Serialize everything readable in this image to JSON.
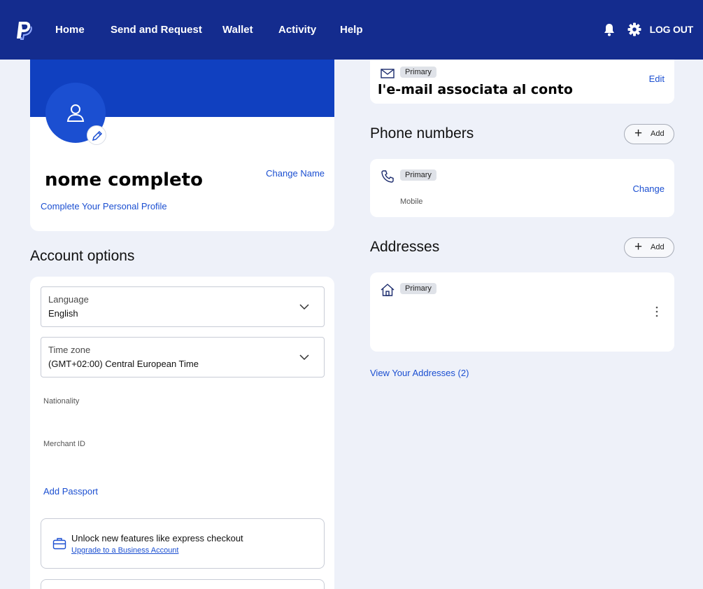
{
  "nav": {
    "items": [
      "Home",
      "Send and Request",
      "Wallet",
      "Activity",
      "Help"
    ],
    "logout": "LOG OUT"
  },
  "profile": {
    "full_name": "nome completo",
    "change_name": "Change Name",
    "complete_profile": "Complete Your Personal Profile"
  },
  "account_options": {
    "title": "Account options",
    "language_label": "Language",
    "language_value": "English",
    "timezone_label": "Time zone",
    "timezone_value": "(GMT+02:00) Central European Time",
    "nationality_label": "Nationality",
    "merchant_label": "Merchant ID",
    "add_passport": "Add Passport",
    "unlock_text": "Unlock new features like express checkout",
    "upgrade_link": "Upgrade to a Business Account"
  },
  "email": {
    "badge": "Primary",
    "value": "l'e-mail associata al conto",
    "edit": "Edit"
  },
  "phones": {
    "title": "Phone numbers",
    "add": "Add",
    "badge": "Primary",
    "type": "Mobile",
    "change": "Change"
  },
  "addresses": {
    "title": "Addresses",
    "add": "Add",
    "badge": "Primary",
    "view_all": "View Your Addresses (2)"
  },
  "colors": {
    "nav_bg": "#142c8e",
    "banner": "#1040c0",
    "link": "#1b4fd1",
    "page_bg": "#eef1f9"
  }
}
